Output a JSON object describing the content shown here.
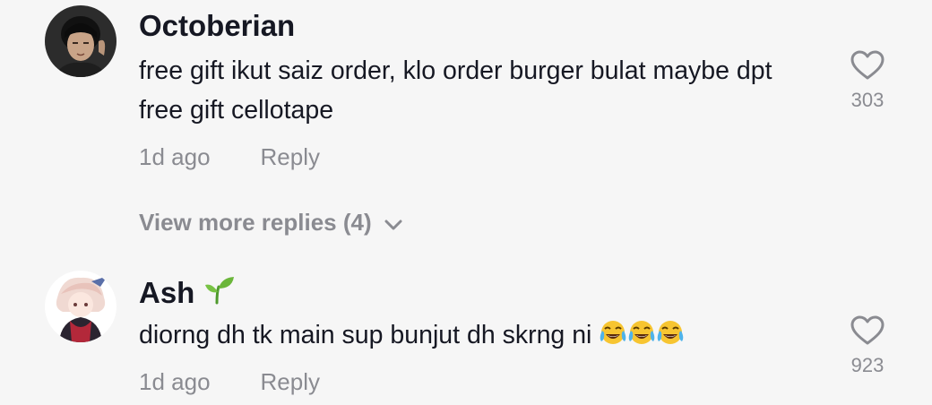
{
  "comments": [
    {
      "username": "Octoberian",
      "text": "free gift ikut saiz order, klo order burger bulat maybe dpt free gift cellotape",
      "time": "1d ago",
      "reply_label": "Reply",
      "likes": "303",
      "avatar_icon": "user-photo-avatar"
    },
    {
      "username": "Ash",
      "username_emoji": "seedling-icon",
      "text": "diorng dh tk main sup bunjut dh skrng ni",
      "text_emoji": [
        "face-with-tears-of-joy-icon",
        "face-with-tears-of-joy-icon",
        "face-with-tears-of-joy-icon"
      ],
      "time": "1d ago",
      "reply_label": "Reply",
      "likes": "923",
      "avatar_icon": "anime-character-avatar"
    }
  ],
  "view_more_replies": "View more replies (4)",
  "colors": {
    "background": "#f6f6f6",
    "primary_text": "#161823",
    "secondary_text": "#8a8b91"
  }
}
